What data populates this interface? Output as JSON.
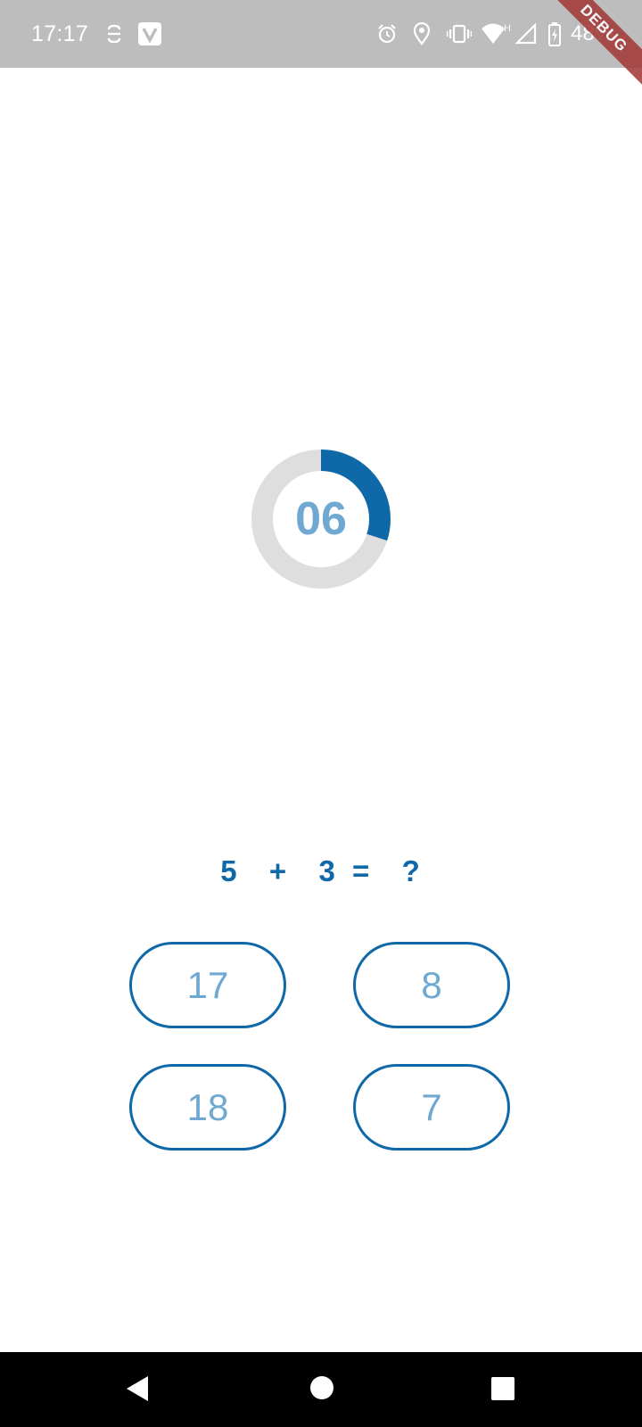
{
  "status_bar": {
    "time": "17:17",
    "battery_percent": "48%",
    "icons": [
      "s-icon",
      "v-app-icon",
      "alarm-icon",
      "location-icon",
      "vibrate-icon",
      "wifi-icon",
      "signal-icon",
      "battery-charging-icon"
    ]
  },
  "debug_banner": {
    "label": "DEBUG"
  },
  "timer": {
    "value": "06",
    "progress": 0.3,
    "colors": {
      "progress": "#0f68a8",
      "track": "#dedede",
      "text": "#6fa8d0"
    }
  },
  "question": {
    "text": "5  +  3 =  ?"
  },
  "answers": [
    {
      "label": "17"
    },
    {
      "label": "8"
    },
    {
      "label": "18"
    },
    {
      "label": "7"
    }
  ],
  "navigation": {
    "buttons": [
      "back-icon",
      "home-icon",
      "recents-icon"
    ]
  },
  "theme": {
    "primary": "#0f68a8",
    "answer_text": "#6fa8d0",
    "status_bar": "#bdbdbd",
    "nav_bar": "#000000"
  }
}
